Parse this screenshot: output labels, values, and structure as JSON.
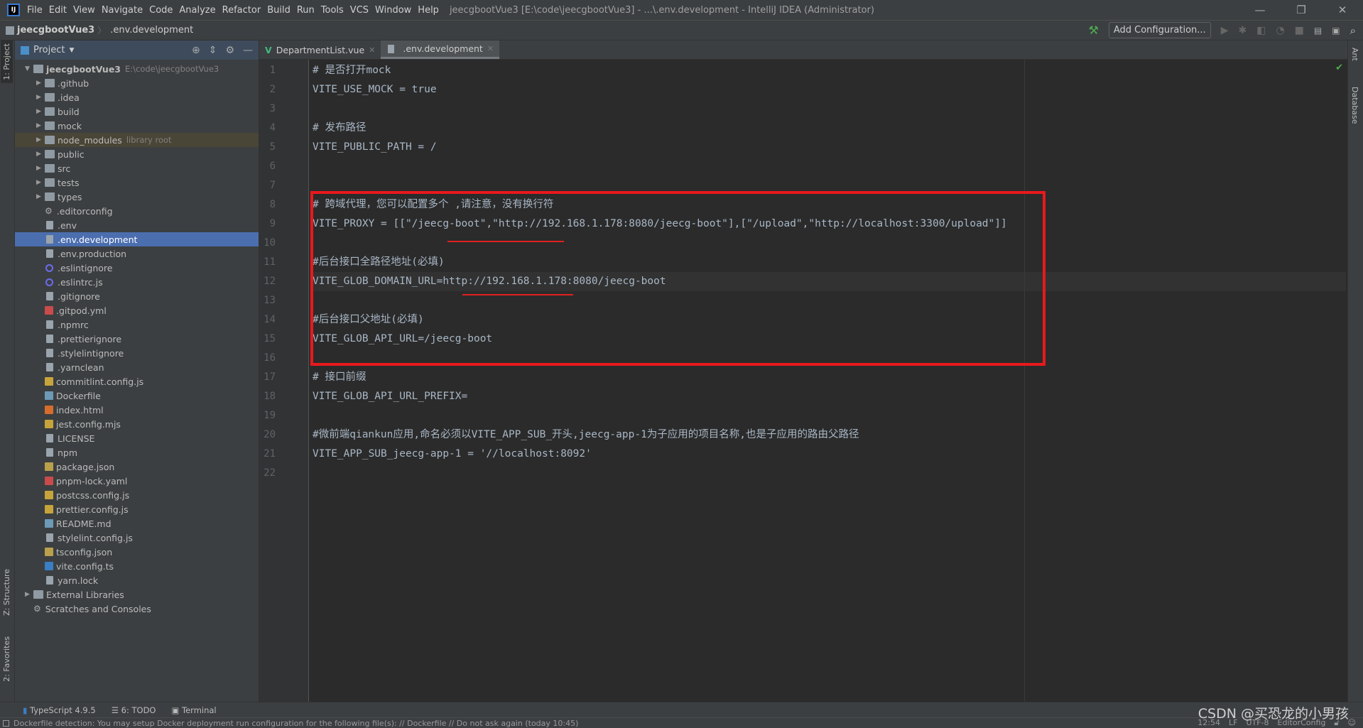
{
  "menubar": {
    "items": [
      "File",
      "Edit",
      "View",
      "Navigate",
      "Code",
      "Analyze",
      "Refactor",
      "Build",
      "Run",
      "Tools",
      "VCS",
      "Window",
      "Help"
    ],
    "title": "jeecgbootVue3 [E:\\code\\jeecgbootVue3] - ...\\.env.development - IntelliJ IDEA (Administrator)"
  },
  "navbar": {
    "project": "jeecgbootVue3",
    "file": ".env.development",
    "add_configuration": "Add Configuration..."
  },
  "left_stripe": {
    "project": "1: Project",
    "structure": "Z: Structure",
    "favorites": "2: Favorites"
  },
  "right_stripe": {
    "ant": "Ant",
    "database": "Database"
  },
  "project_panel": {
    "title": "Project",
    "tree": [
      {
        "name": "jeecgbootVue3",
        "hint": "E:\\code\\jeecgbootVue3",
        "type": "folder",
        "level": 0,
        "open": true
      },
      {
        "name": ".github",
        "type": "folder",
        "level": 1
      },
      {
        "name": ".idea",
        "type": "folder",
        "level": 1
      },
      {
        "name": "build",
        "type": "folder",
        "level": 1
      },
      {
        "name": "mock",
        "type": "folder",
        "level": 1
      },
      {
        "name": "node_modules",
        "hint": "library root",
        "type": "folder",
        "level": 1,
        "lib": true
      },
      {
        "name": "public",
        "type": "folder",
        "level": 1
      },
      {
        "name": "src",
        "type": "folder",
        "level": 1
      },
      {
        "name": "tests",
        "type": "folder",
        "level": 1
      },
      {
        "name": "types",
        "type": "folder",
        "level": 1
      },
      {
        "name": ".editorconfig",
        "type": "gear",
        "level": 1
      },
      {
        "name": ".env",
        "type": "file",
        "level": 1
      },
      {
        "name": ".env.development",
        "type": "file",
        "level": 1,
        "selected": true
      },
      {
        "name": ".env.production",
        "type": "file",
        "level": 1
      },
      {
        "name": ".eslintignore",
        "type": "circle",
        "level": 1
      },
      {
        "name": ".eslintrc.js",
        "type": "circle",
        "level": 1
      },
      {
        "name": ".gitignore",
        "type": "file",
        "level": 1
      },
      {
        "name": ".gitpod.yml",
        "type": "yml",
        "level": 1
      },
      {
        "name": ".npmrc",
        "type": "file",
        "level": 1
      },
      {
        "name": ".prettierignore",
        "type": "file",
        "level": 1
      },
      {
        "name": ".stylelintignore",
        "type": "file",
        "level": 1
      },
      {
        "name": ".yarnclean",
        "type": "file",
        "level": 1
      },
      {
        "name": "commitlint.config.js",
        "type": "js",
        "level": 1
      },
      {
        "name": "Dockerfile",
        "type": "md",
        "level": 1
      },
      {
        "name": "index.html",
        "type": "html",
        "level": 1
      },
      {
        "name": "jest.config.mjs",
        "type": "js",
        "level": 1
      },
      {
        "name": "LICENSE",
        "type": "file",
        "level": 1
      },
      {
        "name": "npm",
        "type": "file",
        "level": 1
      },
      {
        "name": "package.json",
        "type": "json",
        "level": 1
      },
      {
        "name": "pnpm-lock.yaml",
        "type": "yml",
        "level": 1
      },
      {
        "name": "postcss.config.js",
        "type": "js",
        "level": 1
      },
      {
        "name": "prettier.config.js",
        "type": "js",
        "level": 1
      },
      {
        "name": "README.md",
        "type": "md",
        "level": 1
      },
      {
        "name": "stylelint.config.js",
        "type": "file",
        "level": 1
      },
      {
        "name": "tsconfig.json",
        "type": "json",
        "level": 1
      },
      {
        "name": "vite.config.ts",
        "type": "ts",
        "level": 1
      },
      {
        "name": "yarn.lock",
        "type": "file",
        "level": 1
      },
      {
        "name": "External Libraries",
        "type": "folder",
        "level": 0
      },
      {
        "name": "Scratches and Consoles",
        "type": "gear",
        "level": 0
      }
    ]
  },
  "tabs": [
    {
      "label": "DepartmentList.vue",
      "active": false
    },
    {
      "label": ".env.development",
      "active": true
    }
  ],
  "editor": {
    "current_line": 12,
    "lines": [
      "# 是否打开mock",
      "VITE_USE_MOCK = true",
      "",
      "# 发布路径",
      "VITE_PUBLIC_PATH = /",
      "",
      "",
      "# 跨域代理，您可以配置多个 ,请注意，没有换行符",
      "VITE_PROXY = [[\"/jeecg-boot\",\"http://192.168.1.178:8080/jeecg-boot\"],[\"/upload\",\"http://localhost:3300/upload\"]]",
      "",
      "#后台接口全路径地址(必填)",
      "VITE_GLOB_DOMAIN_URL=http://192.168.1.178:8080/jeecg-boot",
      "",
      "#后台接口父地址(必填)",
      "VITE_GLOB_API_URL=/jeecg-boot",
      "",
      "# 接口前缀",
      "VITE_GLOB_API_URL_PREFIX=",
      "",
      "#微前端qiankun应用,命名必须以VITE_APP_SUB_开头,jeecg-app-1为子应用的项目名称,也是子应用的路由父路径",
      "VITE_APP_SUB_jeecg-app-1 = '//localhost:8092'",
      ""
    ]
  },
  "bottom_tools": [
    "TypeScript 4.9.5",
    "6: TODO",
    "Terminal"
  ],
  "status": {
    "message": "Dockerfile detection: You may setup Docker deployment run configuration for the following file(s): // Dockerfile // Do not ask again (today 10:45)",
    "position": "12:54",
    "line_sep": "LF",
    "encoding": "UTF-8",
    "editorconfig": "EditorConfig"
  },
  "watermark": "CSDN @买恐龙的小男孩",
  "colors": {
    "highlight_box": "#e8191d",
    "selection": "#4b6eaf",
    "background": "#2b2b2b"
  }
}
